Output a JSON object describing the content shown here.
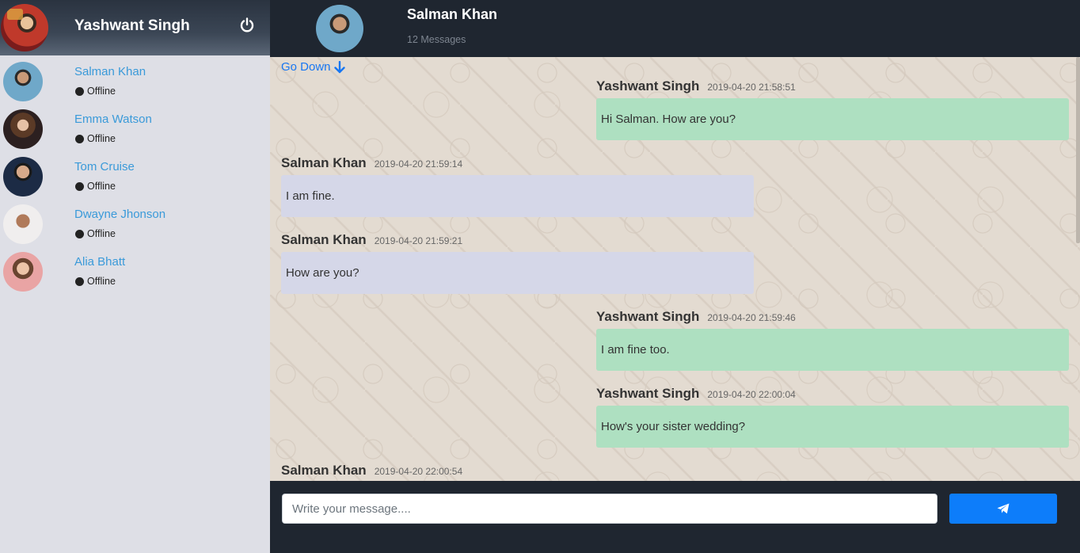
{
  "current_user": {
    "name": "Yashwant Singh",
    "power_icon": "power-icon"
  },
  "contacts": [
    {
      "name": "Salman Khan",
      "status": "Offline"
    },
    {
      "name": "Emma Watson",
      "status": "Offline"
    },
    {
      "name": "Tom Cruise",
      "status": "Offline"
    },
    {
      "name": "Dwayne Jhonson",
      "status": "Offline"
    },
    {
      "name": "Alia Bhatt",
      "status": "Offline"
    }
  ],
  "chat": {
    "title": "Salman Khan",
    "message_count": "12 Messages",
    "go_down_label": "Go Down",
    "messages": [
      {
        "sender": "Yashwant Singh",
        "time": "2019-04-20 21:58:51",
        "text": "Hi Salman. How are you?",
        "direction": "sent"
      },
      {
        "sender": "Salman Khan",
        "time": "2019-04-20 21:59:14",
        "text": "I am fine.",
        "direction": "received"
      },
      {
        "sender": "Salman Khan",
        "time": "2019-04-20 21:59:21",
        "text": "How are you?",
        "direction": "received"
      },
      {
        "sender": "Yashwant Singh",
        "time": "2019-04-20 21:59:46",
        "text": "I am fine too.",
        "direction": "sent"
      },
      {
        "sender": "Yashwant Singh",
        "time": "2019-04-20 22:00:04",
        "text": "How's your sister wedding?",
        "direction": "sent"
      },
      {
        "sender": "Salman Khan",
        "time": "2019-04-20 22:00:54",
        "text": "",
        "direction": "received"
      }
    ]
  },
  "composer": {
    "placeholder": "Write your message....",
    "send_icon": "paper-plane-icon"
  },
  "colors": {
    "sent_bubble": "#aee0c1",
    "received_bubble": "#d5d7e8",
    "accent": "#0d7dfa",
    "contact_name": "#3a9ad9"
  }
}
